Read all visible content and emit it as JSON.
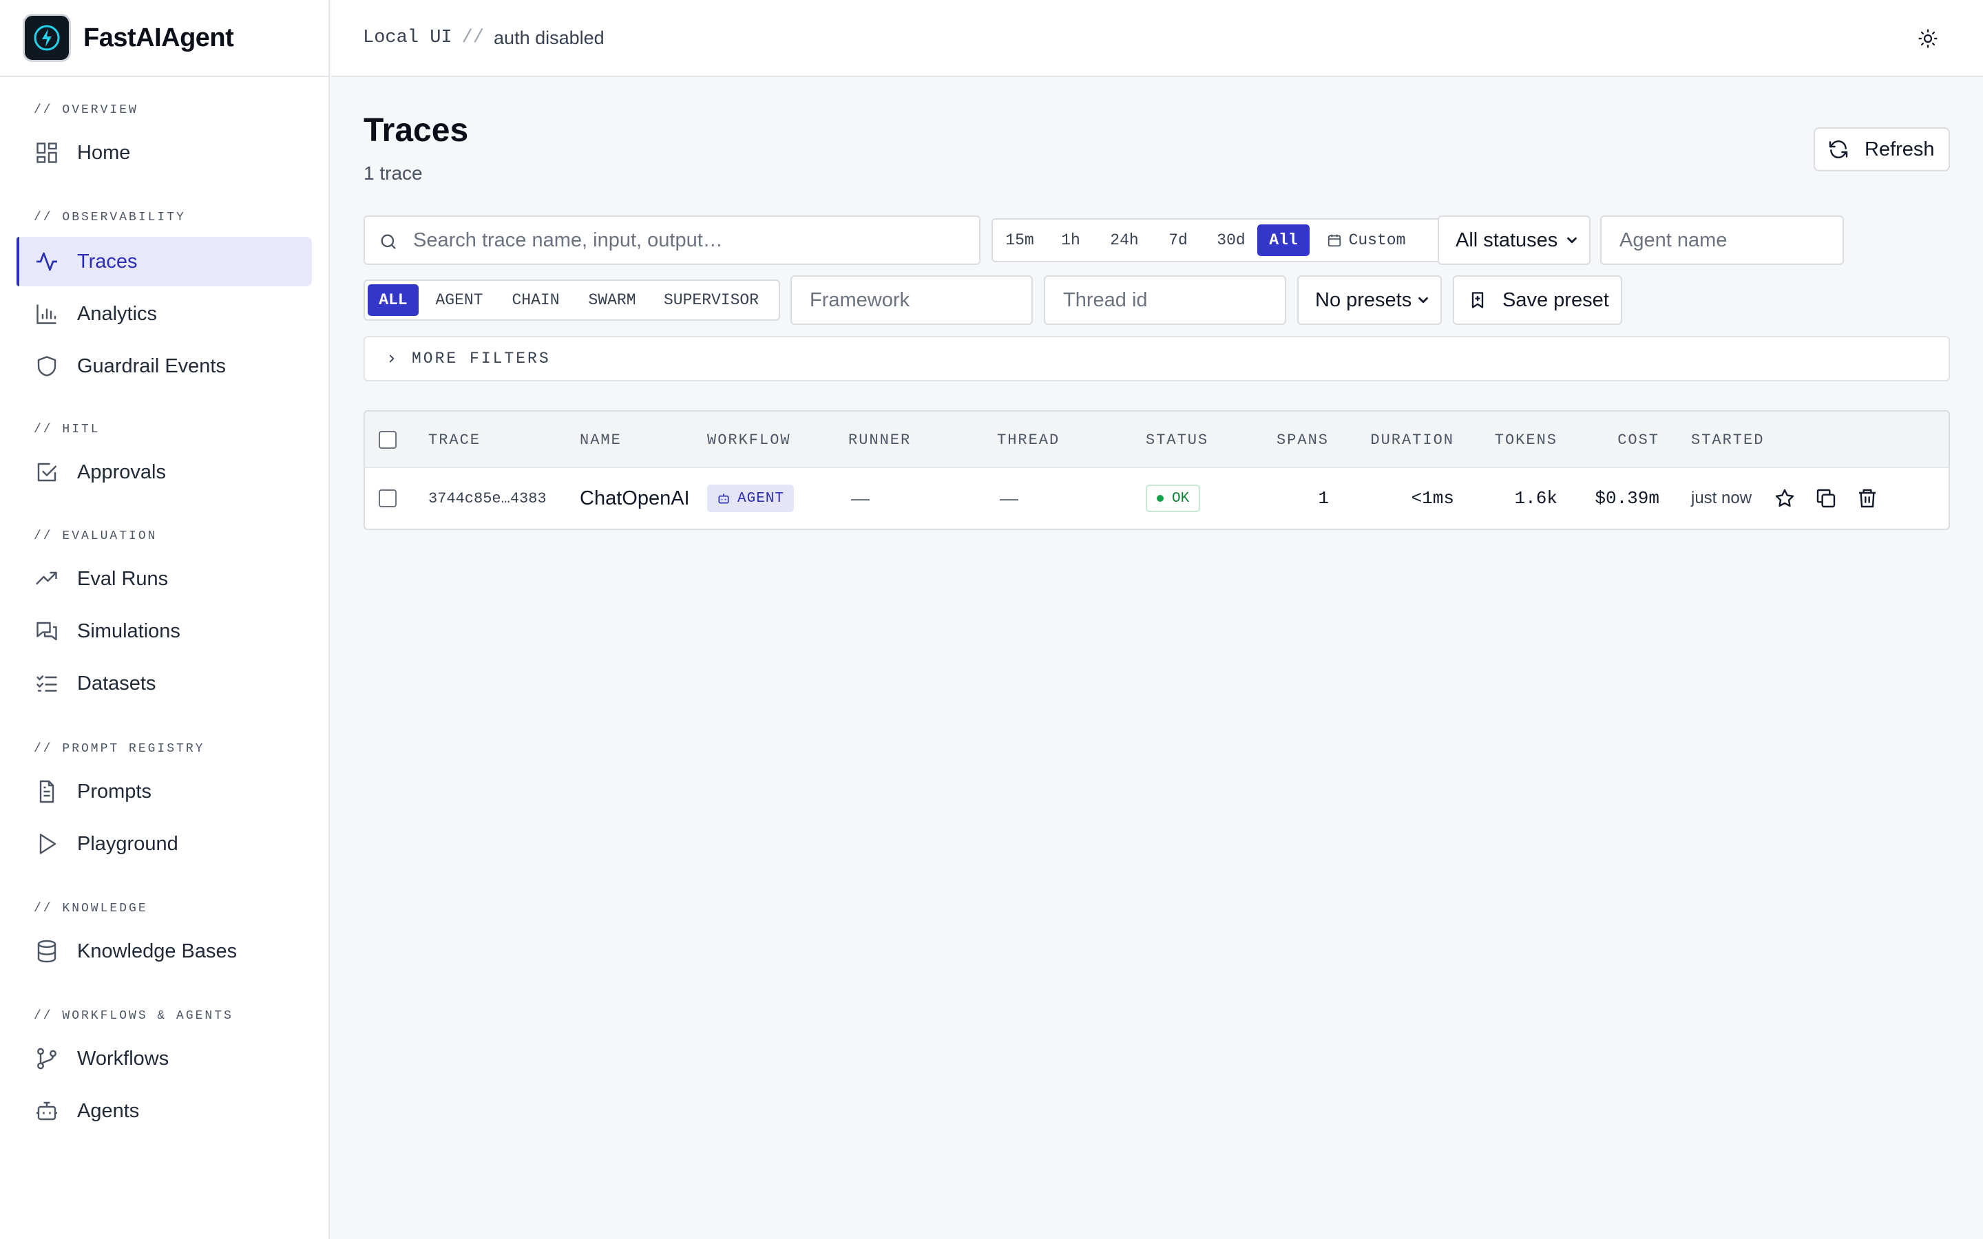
{
  "app": {
    "name": "FastAIAgent"
  },
  "topbar": {
    "mode": "Local UI",
    "separator": "//",
    "auth": "auth disabled"
  },
  "sidebar": {
    "sections": [
      {
        "header": "// OVERVIEW",
        "items": [
          {
            "label": "Home",
            "icon": "grid-icon"
          }
        ]
      },
      {
        "header": "// OBSERVABILITY",
        "items": [
          {
            "label": "Traces",
            "icon": "activity-icon",
            "active": true
          },
          {
            "label": "Analytics",
            "icon": "bar-chart-icon"
          },
          {
            "label": "Guardrail Events",
            "icon": "shield-icon"
          }
        ]
      },
      {
        "header": "// HITL",
        "items": [
          {
            "label": "Approvals",
            "icon": "check-square-icon"
          }
        ]
      },
      {
        "header": "// EVALUATION",
        "items": [
          {
            "label": "Eval Runs",
            "icon": "trending-up-icon"
          },
          {
            "label": "Simulations",
            "icon": "messages-icon"
          },
          {
            "label": "Datasets",
            "icon": "list-checks-icon"
          }
        ]
      },
      {
        "header": "// PROMPT REGISTRY",
        "items": [
          {
            "label": "Prompts",
            "icon": "file-text-icon"
          },
          {
            "label": "Playground",
            "icon": "play-icon"
          }
        ]
      },
      {
        "header": "// KNOWLEDGE",
        "items": [
          {
            "label": "Knowledge Bases",
            "icon": "database-icon"
          }
        ]
      },
      {
        "header": "// WORKFLOWS & AGENTS",
        "items": [
          {
            "label": "Workflows",
            "icon": "git-branch-icon"
          },
          {
            "label": "Agents",
            "icon": "bot-icon"
          }
        ]
      }
    ]
  },
  "page": {
    "title": "Traces",
    "count": "1 trace",
    "refresh_label": "Refresh"
  },
  "filters": {
    "search_placeholder": "Search trace name, input, output…",
    "time_ranges": [
      "15m",
      "1h",
      "24h",
      "7d",
      "30d",
      "All"
    ],
    "time_active": "All",
    "custom_label": "Custom",
    "status_select": "All statuses",
    "agent_placeholder": "Agent name",
    "workflow_types": [
      "ALL",
      "AGENT",
      "CHAIN",
      "SWARM",
      "SUPERVISOR"
    ],
    "workflow_active": "ALL",
    "framework_placeholder": "Framework",
    "thread_placeholder": "Thread id",
    "presets_select": "No presets",
    "save_preset_label": "Save preset",
    "more_filters_label": "MORE FILTERS"
  },
  "table": {
    "columns": [
      "TRACE",
      "NAME",
      "WORKFLOW",
      "RUNNER",
      "THREAD",
      "STATUS",
      "SPANS",
      "DURATION",
      "TOKENS",
      "COST",
      "STARTED"
    ],
    "rows": [
      {
        "trace": "3744c85e…4383",
        "name": "ChatOpenAI",
        "workflow": "AGENT",
        "runner": "—",
        "thread": "—",
        "status": "OK",
        "spans": "1",
        "duration": "<1ms",
        "tokens": "1.6k",
        "cost": "$0.39m",
        "started": "just now"
      }
    ]
  },
  "colors": {
    "accent": "#3237c9",
    "active_bg": "#e8e8fb",
    "ok": "#16a34a"
  }
}
